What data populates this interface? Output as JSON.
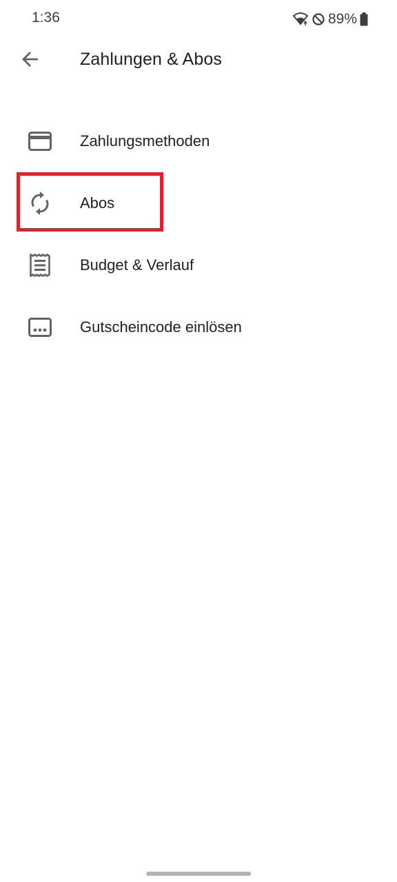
{
  "status_bar": {
    "time": "1:36",
    "battery": "89%"
  },
  "app_bar": {
    "title": "Zahlungen & Abos"
  },
  "menu": {
    "items": [
      {
        "label": "Zahlungsmethoden",
        "icon": "credit-card-icon"
      },
      {
        "label": "Abos",
        "icon": "sync-icon"
      },
      {
        "label": "Budget & Verlauf",
        "icon": "receipt-icon"
      },
      {
        "label": "Gutscheincode einlösen",
        "icon": "redeem-code-icon"
      }
    ]
  },
  "colors": {
    "icon": "#5f6368",
    "highlight": "#e0202e",
    "text": "#202124"
  }
}
